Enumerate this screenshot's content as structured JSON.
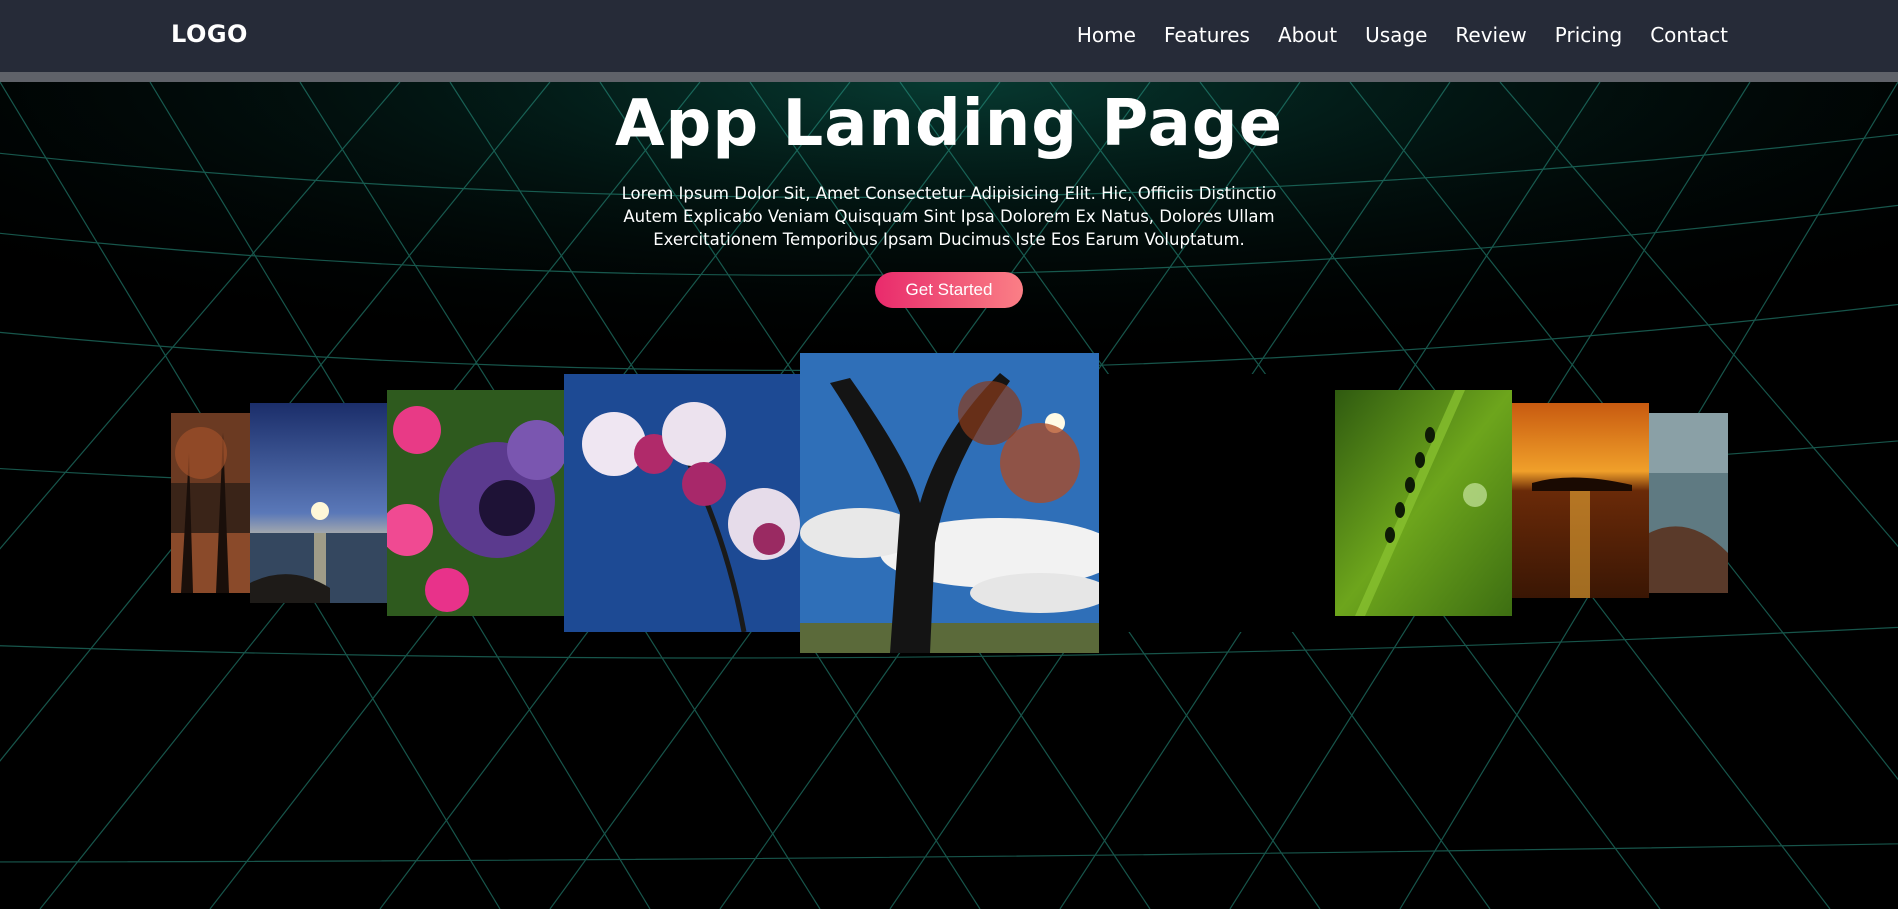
{
  "header": {
    "logo": "LOGO",
    "nav": [
      "Home",
      "Features",
      "About",
      "Usage",
      "Review",
      "Pricing",
      "Contact"
    ]
  },
  "hero": {
    "title": "App Landing Page",
    "description": "Lorem Ipsum Dolor Sit, Amet Consectetur Adipisicing Elit. Hic, Officiis Distinctio Autem Explicabo Veniam Quisquam Sint Ipsa Dolorem Ex Natus, Dolores Ullam Exercitationem Temporibus Ipsam Ducimus Iste Eos Earum Voluptatum.",
    "cta_label": "Get Started"
  },
  "colors": {
    "header_bg": "#262b38",
    "grid_line": "#2a9c89",
    "cta_start": "#e92a6c",
    "cta_end": "#fb7f86"
  }
}
